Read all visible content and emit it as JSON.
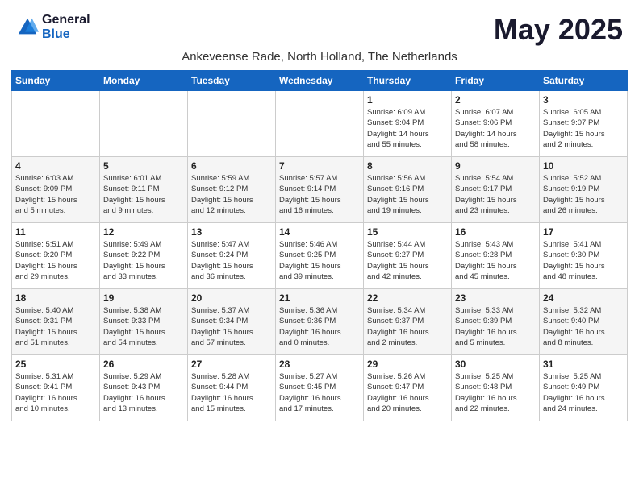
{
  "header": {
    "logo_general": "General",
    "logo_blue": "Blue",
    "month_title": "May 2025",
    "subtitle": "Ankeveense Rade, North Holland, The Netherlands"
  },
  "weekdays": [
    "Sunday",
    "Monday",
    "Tuesday",
    "Wednesday",
    "Thursday",
    "Friday",
    "Saturday"
  ],
  "weeks": [
    [
      {
        "num": "",
        "info": ""
      },
      {
        "num": "",
        "info": ""
      },
      {
        "num": "",
        "info": ""
      },
      {
        "num": "",
        "info": ""
      },
      {
        "num": "1",
        "info": "Sunrise: 6:09 AM\nSunset: 9:04 PM\nDaylight: 14 hours\nand 55 minutes."
      },
      {
        "num": "2",
        "info": "Sunrise: 6:07 AM\nSunset: 9:06 PM\nDaylight: 14 hours\nand 58 minutes."
      },
      {
        "num": "3",
        "info": "Sunrise: 6:05 AM\nSunset: 9:07 PM\nDaylight: 15 hours\nand 2 minutes."
      }
    ],
    [
      {
        "num": "4",
        "info": "Sunrise: 6:03 AM\nSunset: 9:09 PM\nDaylight: 15 hours\nand 5 minutes."
      },
      {
        "num": "5",
        "info": "Sunrise: 6:01 AM\nSunset: 9:11 PM\nDaylight: 15 hours\nand 9 minutes."
      },
      {
        "num": "6",
        "info": "Sunrise: 5:59 AM\nSunset: 9:12 PM\nDaylight: 15 hours\nand 12 minutes."
      },
      {
        "num": "7",
        "info": "Sunrise: 5:57 AM\nSunset: 9:14 PM\nDaylight: 15 hours\nand 16 minutes."
      },
      {
        "num": "8",
        "info": "Sunrise: 5:56 AM\nSunset: 9:16 PM\nDaylight: 15 hours\nand 19 minutes."
      },
      {
        "num": "9",
        "info": "Sunrise: 5:54 AM\nSunset: 9:17 PM\nDaylight: 15 hours\nand 23 minutes."
      },
      {
        "num": "10",
        "info": "Sunrise: 5:52 AM\nSunset: 9:19 PM\nDaylight: 15 hours\nand 26 minutes."
      }
    ],
    [
      {
        "num": "11",
        "info": "Sunrise: 5:51 AM\nSunset: 9:20 PM\nDaylight: 15 hours\nand 29 minutes."
      },
      {
        "num": "12",
        "info": "Sunrise: 5:49 AM\nSunset: 9:22 PM\nDaylight: 15 hours\nand 33 minutes."
      },
      {
        "num": "13",
        "info": "Sunrise: 5:47 AM\nSunset: 9:24 PM\nDaylight: 15 hours\nand 36 minutes."
      },
      {
        "num": "14",
        "info": "Sunrise: 5:46 AM\nSunset: 9:25 PM\nDaylight: 15 hours\nand 39 minutes."
      },
      {
        "num": "15",
        "info": "Sunrise: 5:44 AM\nSunset: 9:27 PM\nDaylight: 15 hours\nand 42 minutes."
      },
      {
        "num": "16",
        "info": "Sunrise: 5:43 AM\nSunset: 9:28 PM\nDaylight: 15 hours\nand 45 minutes."
      },
      {
        "num": "17",
        "info": "Sunrise: 5:41 AM\nSunset: 9:30 PM\nDaylight: 15 hours\nand 48 minutes."
      }
    ],
    [
      {
        "num": "18",
        "info": "Sunrise: 5:40 AM\nSunset: 9:31 PM\nDaylight: 15 hours\nand 51 minutes."
      },
      {
        "num": "19",
        "info": "Sunrise: 5:38 AM\nSunset: 9:33 PM\nDaylight: 15 hours\nand 54 minutes."
      },
      {
        "num": "20",
        "info": "Sunrise: 5:37 AM\nSunset: 9:34 PM\nDaylight: 15 hours\nand 57 minutes."
      },
      {
        "num": "21",
        "info": "Sunrise: 5:36 AM\nSunset: 9:36 PM\nDaylight: 16 hours\nand 0 minutes."
      },
      {
        "num": "22",
        "info": "Sunrise: 5:34 AM\nSunset: 9:37 PM\nDaylight: 16 hours\nand 2 minutes."
      },
      {
        "num": "23",
        "info": "Sunrise: 5:33 AM\nSunset: 9:39 PM\nDaylight: 16 hours\nand 5 minutes."
      },
      {
        "num": "24",
        "info": "Sunrise: 5:32 AM\nSunset: 9:40 PM\nDaylight: 16 hours\nand 8 minutes."
      }
    ],
    [
      {
        "num": "25",
        "info": "Sunrise: 5:31 AM\nSunset: 9:41 PM\nDaylight: 16 hours\nand 10 minutes."
      },
      {
        "num": "26",
        "info": "Sunrise: 5:29 AM\nSunset: 9:43 PM\nDaylight: 16 hours\nand 13 minutes."
      },
      {
        "num": "27",
        "info": "Sunrise: 5:28 AM\nSunset: 9:44 PM\nDaylight: 16 hours\nand 15 minutes."
      },
      {
        "num": "28",
        "info": "Sunrise: 5:27 AM\nSunset: 9:45 PM\nDaylight: 16 hours\nand 17 minutes."
      },
      {
        "num": "29",
        "info": "Sunrise: 5:26 AM\nSunset: 9:47 PM\nDaylight: 16 hours\nand 20 minutes."
      },
      {
        "num": "30",
        "info": "Sunrise: 5:25 AM\nSunset: 9:48 PM\nDaylight: 16 hours\nand 22 minutes."
      },
      {
        "num": "31",
        "info": "Sunrise: 5:25 AM\nSunset: 9:49 PM\nDaylight: 16 hours\nand 24 minutes."
      }
    ]
  ]
}
